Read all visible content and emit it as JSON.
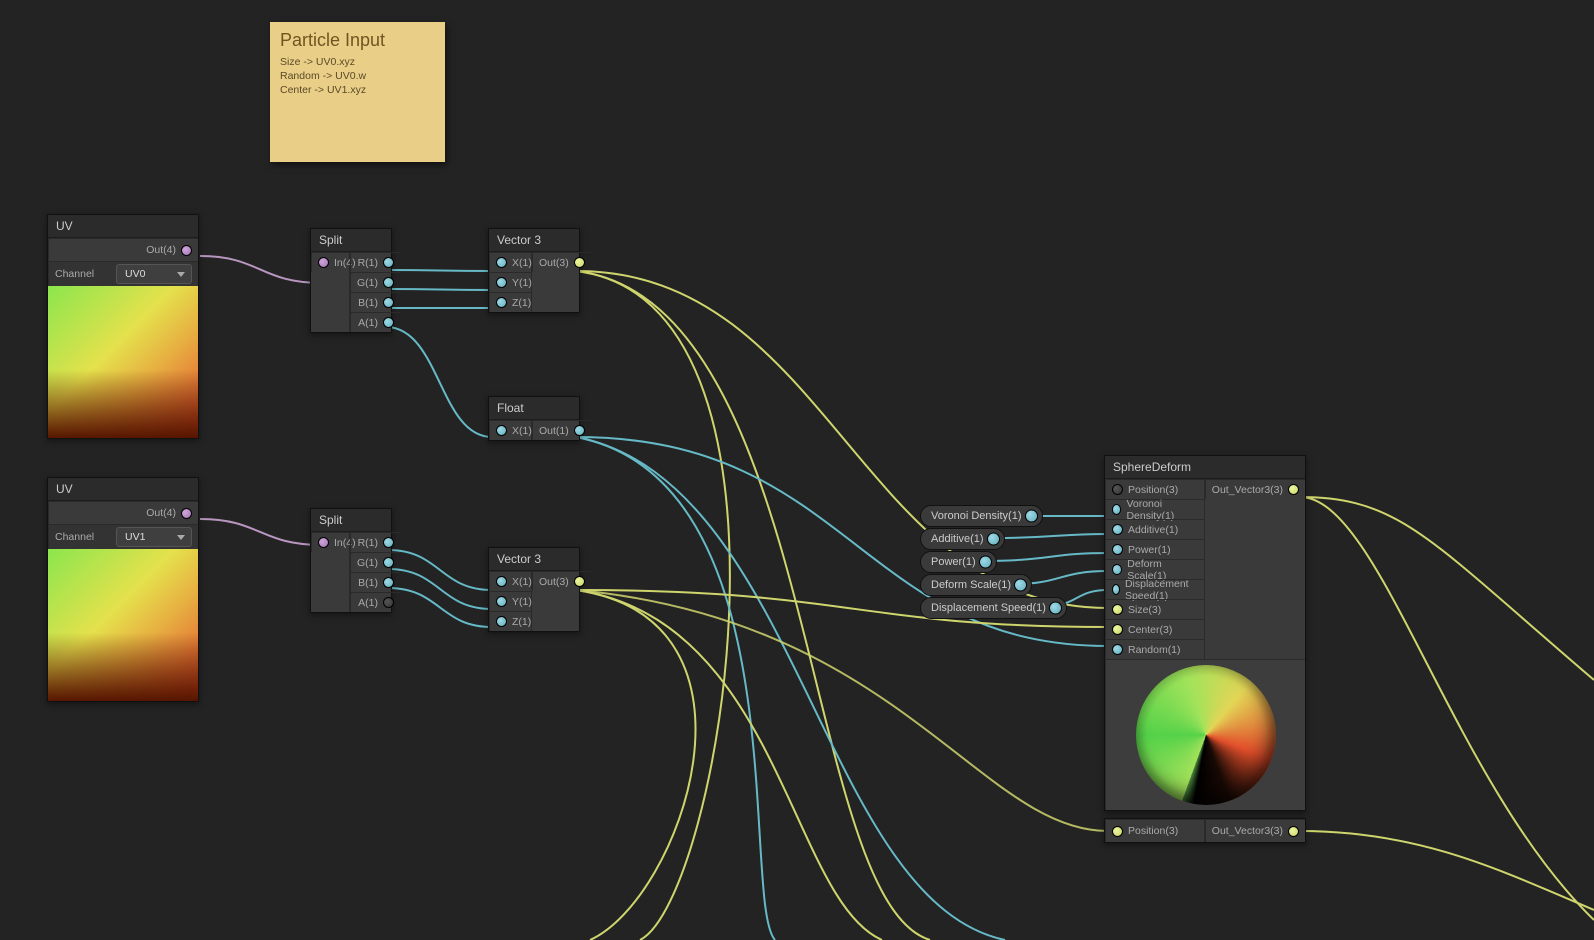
{
  "note": {
    "title": "Particle Input",
    "lines": [
      "Size -> UV0.xyz",
      "Random -> UV0.w",
      "Center -> UV1.xyz"
    ]
  },
  "uv0": {
    "title": "UV",
    "out": "Out(4)",
    "channel_label": "Channel",
    "channel_value": "UV0"
  },
  "uv1": {
    "title": "UV",
    "out": "Out(4)",
    "channel_label": "Channel",
    "channel_value": "UV1"
  },
  "split0": {
    "title": "Split",
    "in": "In(4)",
    "r": "R(1)",
    "g": "G(1)",
    "b": "B(1)",
    "a": "A(1)"
  },
  "split1": {
    "title": "Split",
    "in": "In(4)",
    "r": "R(1)",
    "g": "G(1)",
    "b": "B(1)",
    "a": "A(1)"
  },
  "vec3a": {
    "title": "Vector 3",
    "x": "X(1)",
    "y": "Y(1)",
    "z": "Z(1)",
    "out": "Out(3)"
  },
  "vec3b": {
    "title": "Vector 3",
    "x": "X(1)",
    "y": "Y(1)",
    "z": "Z(1)",
    "out": "Out(3)"
  },
  "float0": {
    "title": "Float",
    "x": "X(1)",
    "out": "Out(1)"
  },
  "props": {
    "voronoi": "Voronoi Density(1)",
    "additive": "Additive(1)",
    "power": "Power(1)",
    "deform": "Deform Scale(1)",
    "disp": "Displacement Speed(1)"
  },
  "sphere": {
    "title": "SphereDeform",
    "out": "Out_Vector3(3)",
    "ins": {
      "position": "Position(3)",
      "voronoi": "Voronoi Density(1)",
      "additive": "Additive(1)",
      "power": "Power(1)",
      "deform": "Deform Scale(1)",
      "disp": "Displacement Speed(1)",
      "size": "Size(3)",
      "center": "Center(3)",
      "random": "Random(1)"
    }
  },
  "sphere2": {
    "inPosition": "Position(3)",
    "out": "Out_Vector3(3)"
  }
}
